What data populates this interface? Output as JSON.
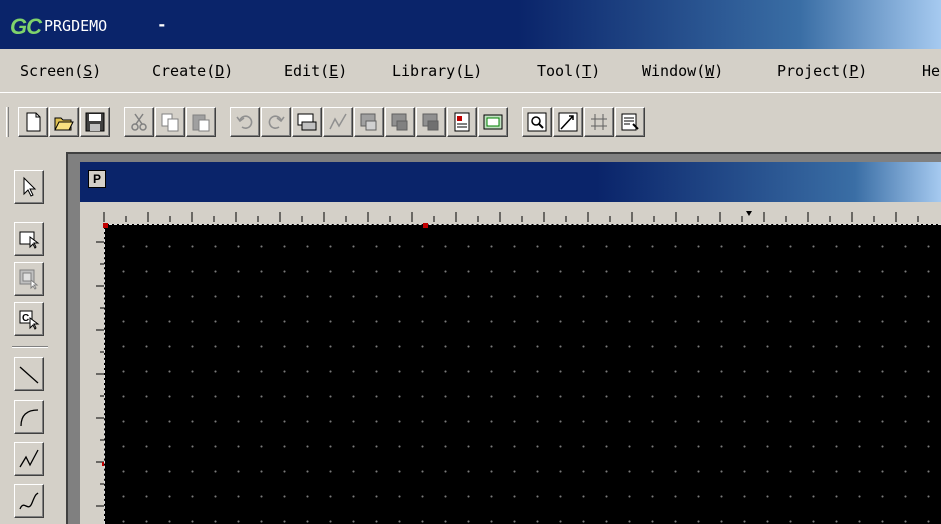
{
  "app": {
    "logo_text": "GC",
    "title": "PRGDEMO",
    "title_separator": "-"
  },
  "menu": {
    "items": [
      {
        "label": "Screen",
        "key": "S"
      },
      {
        "label": "Create",
        "key": "D"
      },
      {
        "label": "Edit",
        "key": "E"
      },
      {
        "label": "Library",
        "key": "L"
      },
      {
        "label": "Tool",
        "key": "T"
      },
      {
        "label": "Window",
        "key": "W"
      },
      {
        "label": "Project",
        "key": "P"
      },
      {
        "label": "He",
        "key": ""
      }
    ]
  },
  "toolbar": {
    "buttons": [
      "new-file-icon",
      "open-folder-icon",
      "save-icon",
      "cut-icon",
      "copy-icon",
      "paste-icon",
      "undo-icon",
      "redo-icon",
      "screen-property-icon",
      "graph-icon",
      "object-a-icon",
      "object-b-icon",
      "object-c-icon",
      "report-icon",
      "screen-switch-icon",
      "zoom-icon",
      "trend-icon",
      "grid-icon",
      "list-icon"
    ]
  },
  "left_toolbar": {
    "buttons": [
      "select-arrow-icon",
      "touch-select-icon",
      "group-select-icon",
      "copy-select-icon",
      "line-icon",
      "arc-icon",
      "polyline-icon",
      "curve-icon"
    ]
  },
  "child_window": {
    "icon_letter": "P"
  },
  "colors": {
    "title_bar": "#0a246a",
    "canvas": "#000000",
    "face": "#d4d0c8"
  }
}
